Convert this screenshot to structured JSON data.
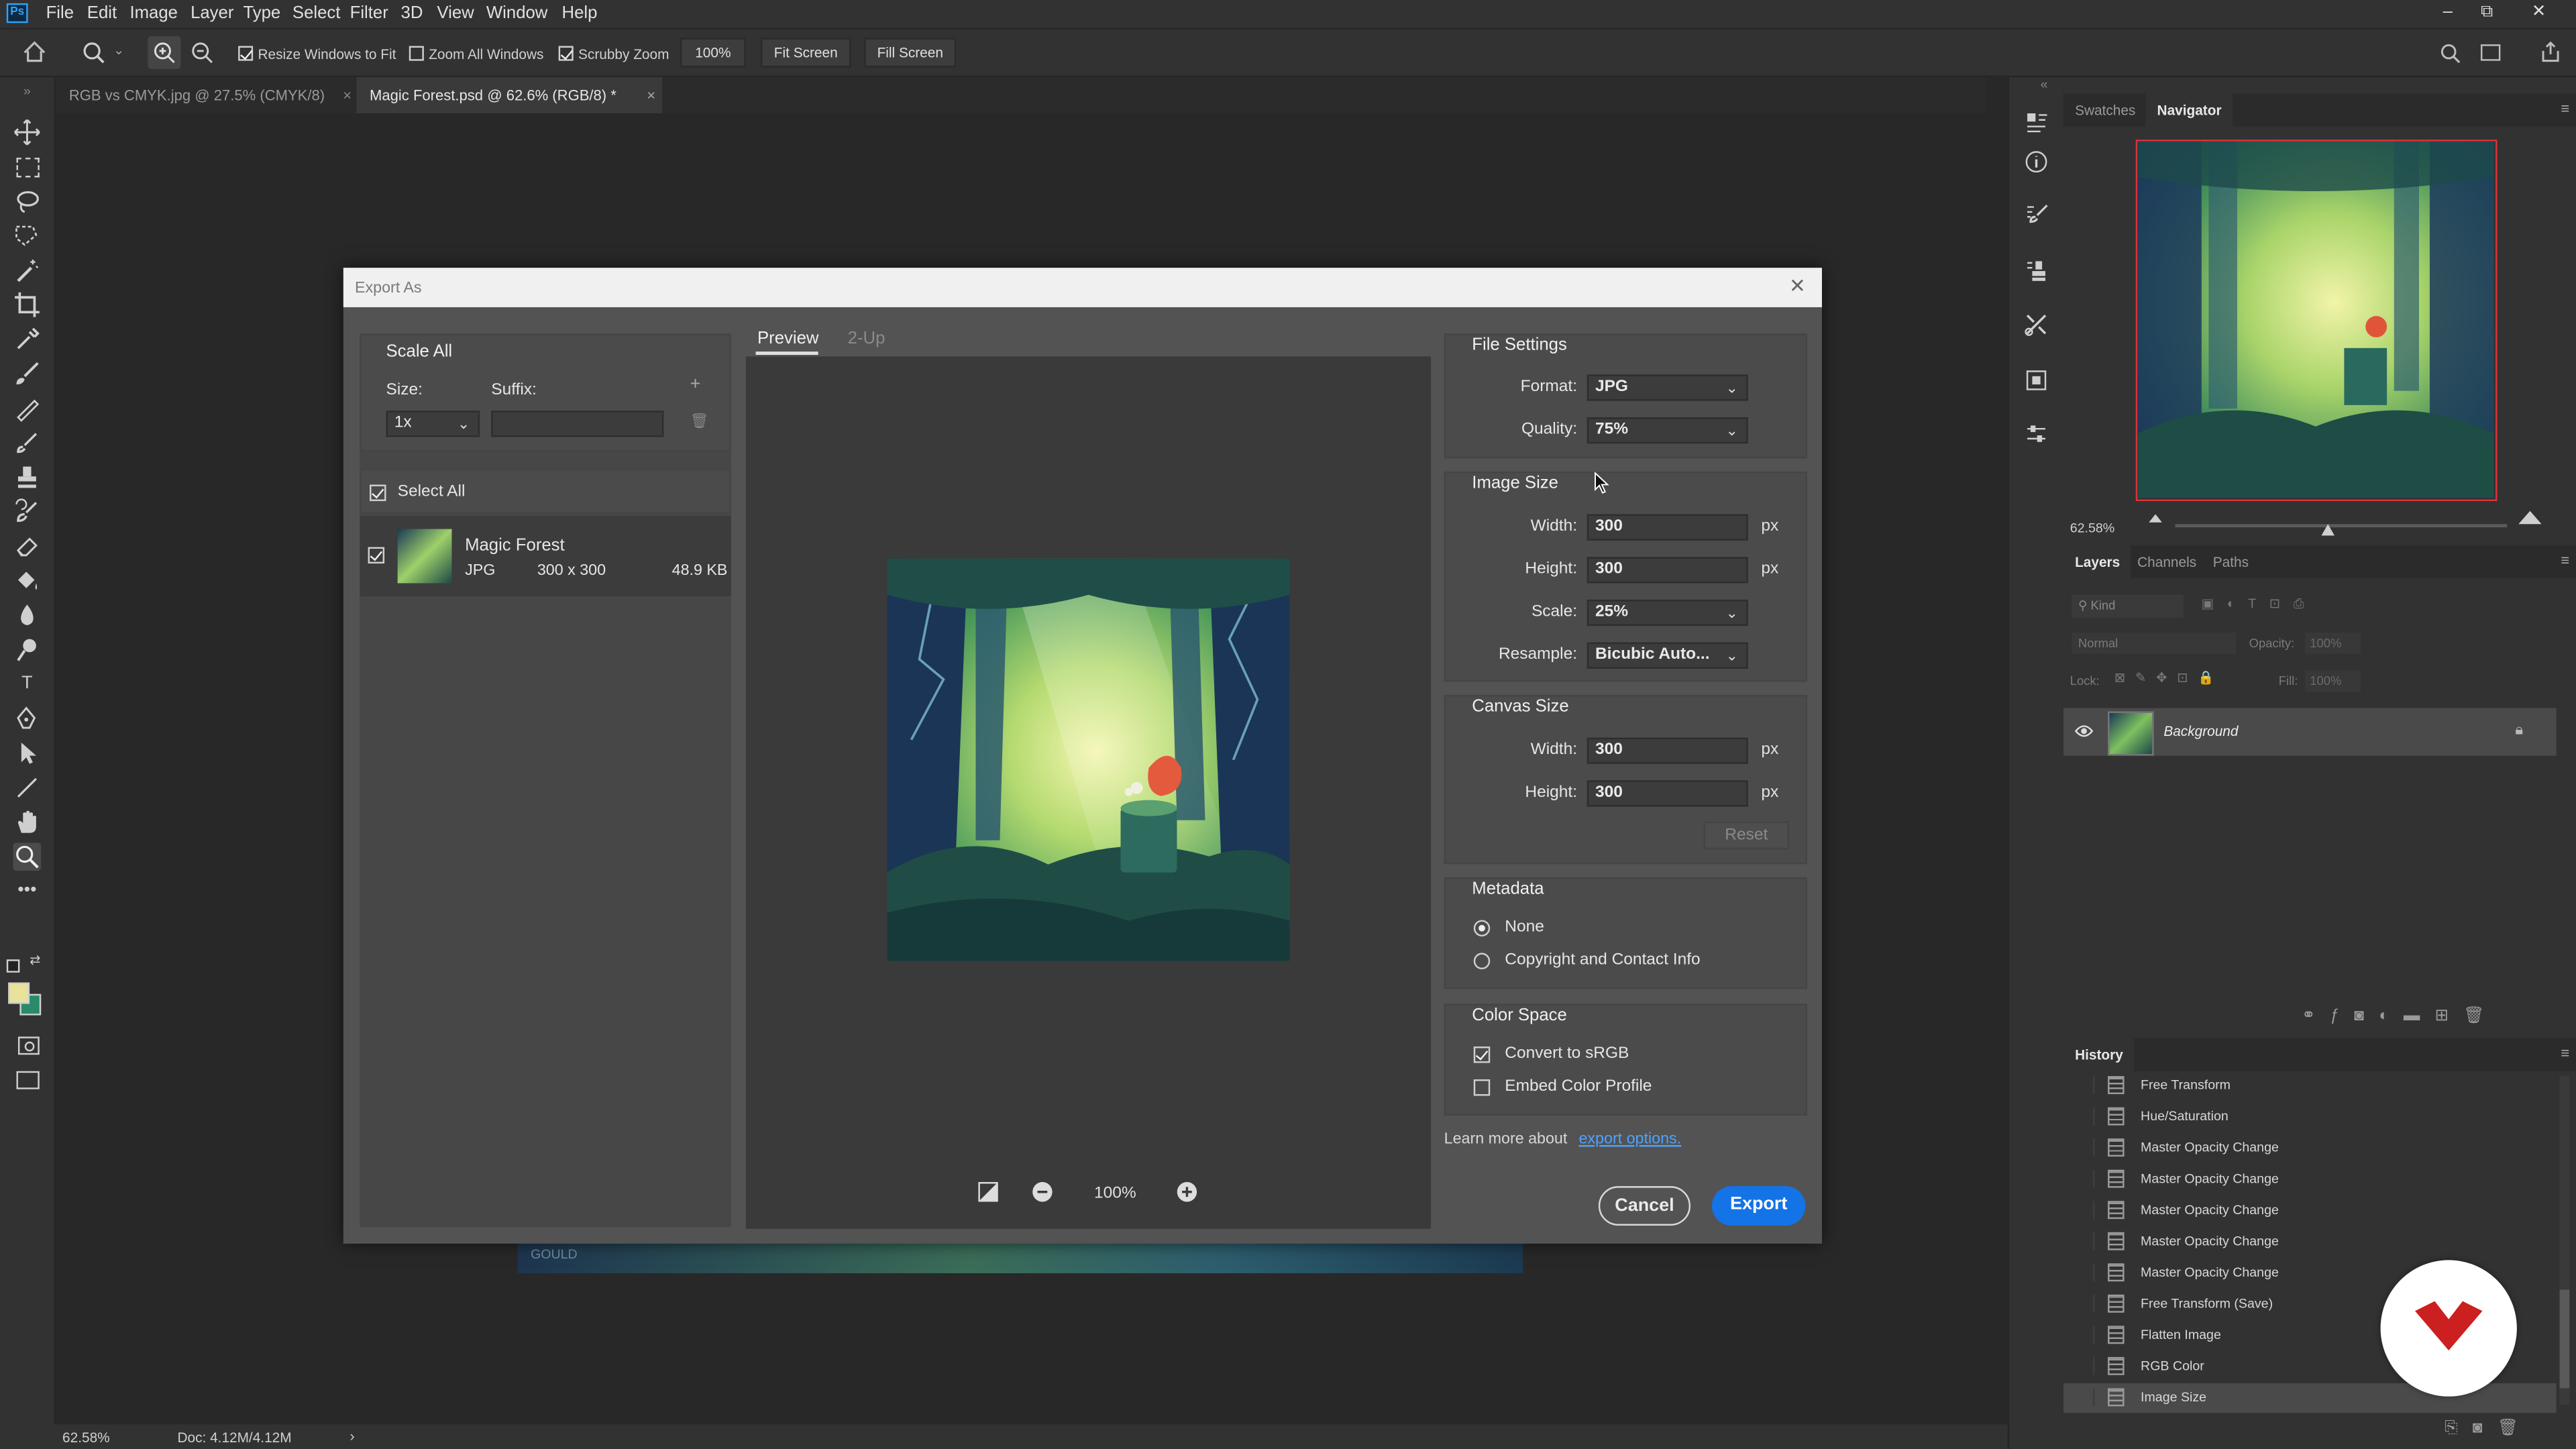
{
  "app": {
    "logo": "Ps",
    "menu": [
      "File",
      "Edit",
      "Image",
      "Layer",
      "Type",
      "Select",
      "Filter",
      "3D",
      "View",
      "Window",
      "Help"
    ],
    "window_controls": {
      "minimize": "–",
      "restore": "⧉",
      "close": "✕"
    }
  },
  "options_bar": {
    "resize_windows": "Resize Windows to Fit",
    "zoom_all": "Zoom All Windows",
    "scrubby_zoom": "Scrubby Zoom",
    "zoom_value": "100%",
    "fit_screen": "Fit Screen",
    "fill_screen": "Fill Screen",
    "resize_checked": true,
    "zoom_all_checked": false,
    "scrubby_checked": true
  },
  "documents": [
    {
      "label": "RGB vs CMYK.jpg @ 27.5% (CMYK/8)",
      "active": false
    },
    {
      "label": "Magic Forest.psd @ 62.6% (RGB/8) *",
      "active": true
    }
  ],
  "status_bar": {
    "zoom": "62.58%",
    "doc": "Doc: 4.12M/4.12M",
    "arrow": "›"
  },
  "dialog": {
    "title": "Export As",
    "close_label": "✕",
    "scale_all": {
      "heading": "Scale All",
      "size_label": "Size:",
      "suffix_label": "Suffix:",
      "size_value": "1x",
      "suffix_value": "",
      "add": "+"
    },
    "select_all": {
      "label": "Select All",
      "checked": true
    },
    "asset": {
      "name": "Magic Forest",
      "format": "JPG",
      "dimensions": "300 x 300",
      "filesize": "48.9 KB",
      "checked": true
    },
    "preview_tabs": [
      "Preview",
      "2-Up"
    ],
    "preview_zoom": "100%",
    "file_settings": {
      "heading": "File Settings",
      "format_label": "Format:",
      "format_value": "JPG",
      "quality_label": "Quality:",
      "quality_value": "75%"
    },
    "image_size": {
      "heading": "Image Size",
      "width_label": "Width:",
      "width_value": "300",
      "height_label": "Height:",
      "height_value": "300",
      "scale_label": "Scale:",
      "scale_value": "25%",
      "resample_label": "Resample:",
      "resample_value": "Bicubic Auto...",
      "unit": "px"
    },
    "canvas_size": {
      "heading": "Canvas Size",
      "width_label": "Width:",
      "width_value": "300",
      "height_label": "Height:",
      "height_value": "300",
      "unit": "px",
      "reset": "Reset"
    },
    "metadata": {
      "heading": "Metadata",
      "options": [
        "None",
        "Copyright and Contact Info"
      ],
      "selected": 0
    },
    "color_space": {
      "heading": "Color Space",
      "convert": "Convert to sRGB",
      "convert_checked": true,
      "embed": "Embed Color Profile",
      "embed_checked": false
    },
    "learn_more": "Learn more about",
    "learn_link": "export options.",
    "cancel": "Cancel",
    "export": "Export"
  },
  "navigator": {
    "tabs": [
      "Swatches",
      "Navigator"
    ],
    "zoom": "62.58%"
  },
  "layers": {
    "tabs": [
      "Layers",
      "Channels",
      "Paths"
    ],
    "kind": "Kind",
    "blend": "Normal",
    "opacity_label": "Opacity:",
    "opacity_value": "100%",
    "lock_label": "Lock:",
    "fill_label": "Fill:",
    "fill_value": "100%",
    "layer_name": "Background"
  },
  "history": {
    "heading": "History",
    "items": [
      "Free Transform",
      "Hue/Saturation",
      "Master Opacity Change",
      "Master Opacity Change",
      "Master Opacity Change",
      "Master Opacity Change",
      "Master Opacity Change",
      "Free Transform (Save)",
      "Flatten Image",
      "RGB Color",
      "Image Size"
    ]
  },
  "colors": {
    "accent": "#1473e6",
    "nav_frame": "#e0303a",
    "bg": "#282828",
    "panel": "#323232",
    "dialog": "#535353",
    "fg_swatch": "#e8e29a",
    "bg_swatch": "#2a8a6a"
  }
}
